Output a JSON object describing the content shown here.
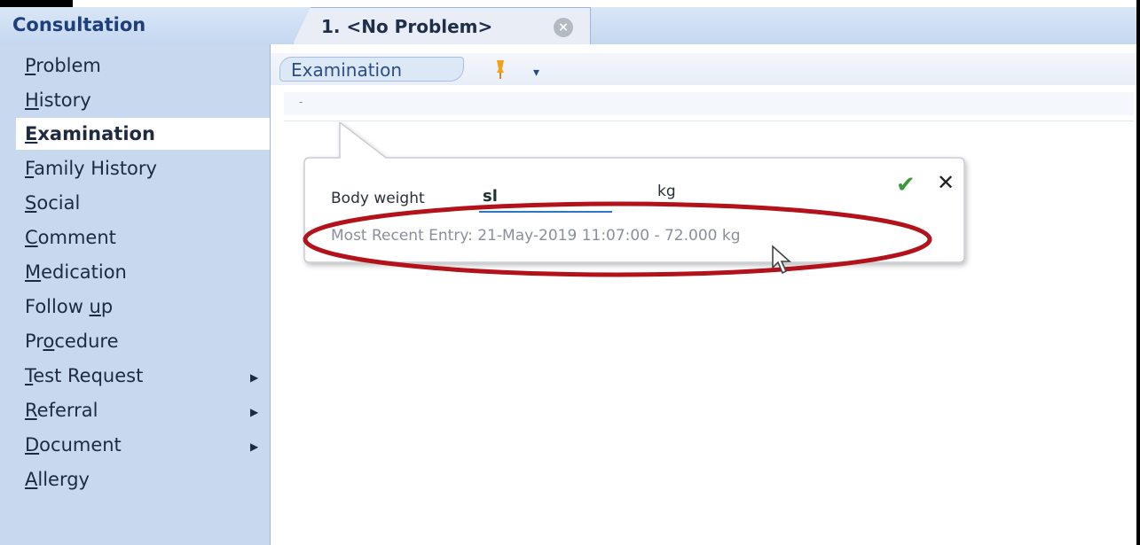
{
  "header": {
    "title": "Consultation",
    "tab_label": "1. <No Problem>",
    "tab_close_icon": "close-circle-icon"
  },
  "sidebar": {
    "items": [
      {
        "label_u": "P",
        "label_rest": "roblem",
        "active": false,
        "submenu": false
      },
      {
        "label_u": "H",
        "label_rest": "istory",
        "active": false,
        "submenu": false
      },
      {
        "label_u": "E",
        "label_rest": "xamination",
        "active": true,
        "submenu": false
      },
      {
        "label_u": "F",
        "label_rest": "amily History",
        "active": false,
        "submenu": false
      },
      {
        "label_u": "S",
        "label_rest": "ocial",
        "active": false,
        "submenu": false
      },
      {
        "label_u": "C",
        "label_rest": "omment",
        "active": false,
        "submenu": false
      },
      {
        "label_u": "M",
        "label_rest": "edication",
        "active": false,
        "submenu": false
      },
      {
        "label_pre": "Follow ",
        "label_u": "u",
        "label_rest": "p",
        "active": false,
        "submenu": false
      },
      {
        "label_pre": "Pr",
        "label_u": "o",
        "label_rest": "cedure",
        "active": false,
        "submenu": false
      },
      {
        "label_u": "T",
        "label_rest": "est Request",
        "active": false,
        "submenu": true
      },
      {
        "label_u": "R",
        "label_rest": "eferral",
        "active": false,
        "submenu": true
      },
      {
        "label_u": "D",
        "label_rest": "ocument",
        "active": false,
        "submenu": true
      },
      {
        "label_u": "A",
        "label_rest": "llergy",
        "active": false,
        "submenu": false
      }
    ]
  },
  "main": {
    "section_label": "Examination",
    "pin_icon": "pin-icon",
    "dropdown_icon": "chevron-down-icon",
    "entry_bullet": "-"
  },
  "popup": {
    "field_label": "Body weight",
    "field_value": "sl",
    "unit": "kg",
    "confirm_icon": "checkmark-icon",
    "cancel_icon": "close-icon",
    "most_recent": "Most Recent Entry: 21-May-2019 11:07:00 - 72.000 kg"
  },
  "colors": {
    "sidebar_bg": "#c7d8ef",
    "title_color": "#1f3f7a",
    "highlight_ellipse": "#b3121b",
    "confirm_green": "#3a9a3a",
    "input_underline": "#2b76c9"
  }
}
